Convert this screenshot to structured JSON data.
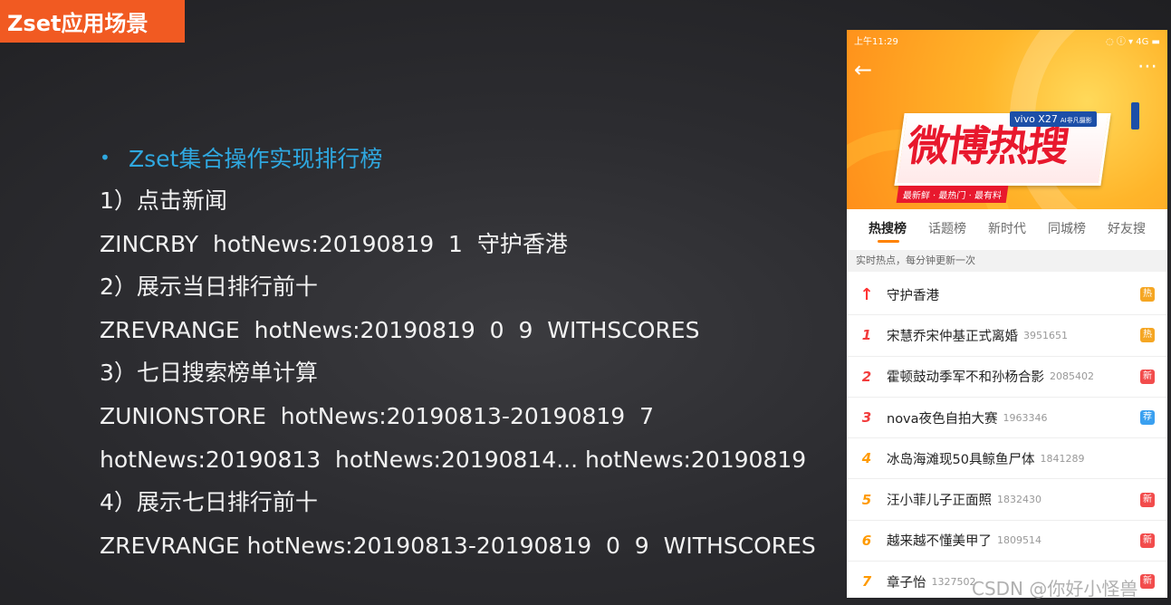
{
  "slide": {
    "title": "Zset应用场景",
    "bullet": "Zset集合操作实现排行榜",
    "lines": [
      "1）点击新闻",
      "ZINCRBY  hotNews:20190819  1  守护香港",
      "2）展示当日排行前十",
      "ZREVRANGE  hotNews:20190819  0  9  WITHSCORES",
      "3）七日搜索榜单计算",
      "ZUNIONSTORE  hotNews:20190813-20190819  7",
      "hotNews:20190813  hotNews:20190814... hotNews:20190819",
      "4）展示七日排行前十",
      "ZREVRANGE hotNews:20190813-20190819  0  9  WITHSCORES"
    ]
  },
  "phone": {
    "status": {
      "time": "上午11:29",
      "right": "◌ ⓘ ▾ 4G ▬"
    },
    "banner": {
      "logo_text": "微博热搜",
      "sub": "最新鲜 · 最热门 · 最有料",
      "ad_model": "vivo X27",
      "ad_tag": "AI非凡摄影"
    },
    "tabs": [
      "热搜榜",
      "话题榜",
      "新时代",
      "同城榜",
      "好友搜"
    ],
    "hint": "实时热点，每分钟更新一次",
    "rows": [
      {
        "rank": "↑",
        "topic": "守护香港",
        "count": "",
        "badge": "热",
        "badge_color": "#f5a623"
      },
      {
        "rank": "1",
        "topic": "宋慧乔宋仲基正式离婚",
        "count": "3951651",
        "badge": "热",
        "badge_color": "#f5a623"
      },
      {
        "rank": "2",
        "topic": "霍顿鼓动季军不和孙杨合影",
        "count": "2085402",
        "badge": "新",
        "badge_color": "#f24c4c"
      },
      {
        "rank": "3",
        "topic": "nova夜色自拍大赛",
        "count": "1963346",
        "badge": "荐",
        "badge_color": "#3aa0f0"
      },
      {
        "rank": "4",
        "topic": "冰岛海滩现50具鲸鱼尸体",
        "count": "1841289",
        "badge": "",
        "badge_color": ""
      },
      {
        "rank": "5",
        "topic": "汪小菲儿子正面照",
        "count": "1832430",
        "badge": "新",
        "badge_color": "#f24c4c"
      },
      {
        "rank": "6",
        "topic": "越来越不懂美甲了",
        "count": "1809514",
        "badge": "新",
        "badge_color": "#f24c4c"
      },
      {
        "rank": "7",
        "topic": "章子怡",
        "count": "1327502",
        "badge": "新",
        "badge_color": "#f24c4c"
      }
    ]
  },
  "watermark": "CSDN @你好小怪兽"
}
